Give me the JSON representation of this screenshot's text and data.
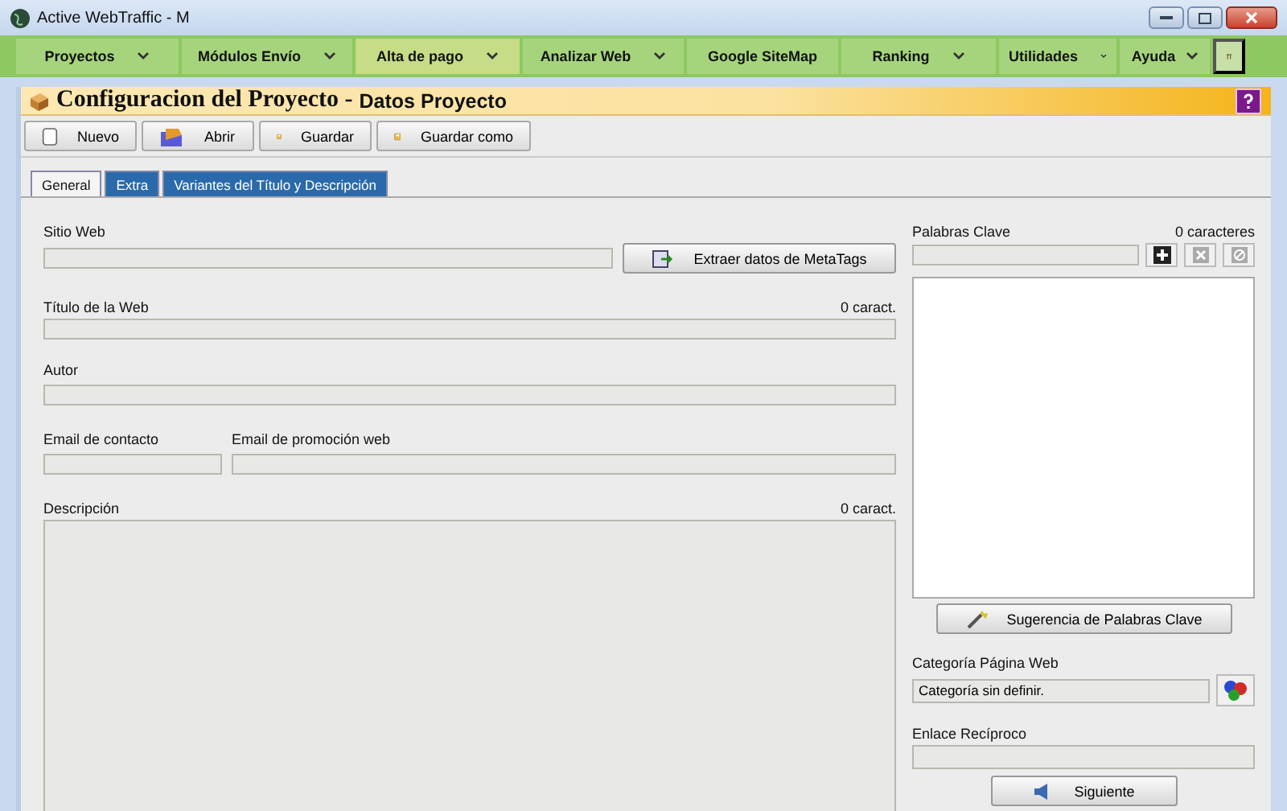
{
  "window": {
    "title": "Active WebTraffic - M"
  },
  "menu": [
    {
      "label": "Proyectos",
      "selected": false,
      "dropdown": true
    },
    {
      "label": "Módulos Envío",
      "selected": false,
      "dropdown": true
    },
    {
      "label": "Alta de pago",
      "selected": true,
      "dropdown": true
    },
    {
      "label": "Analizar Web",
      "selected": false,
      "dropdown": true
    },
    {
      "label": "Google SiteMap",
      "selected": false,
      "dropdown": false
    },
    {
      "label": "Ranking",
      "selected": false,
      "dropdown": true
    },
    {
      "label": "Utilidades",
      "selected": false,
      "dropdown": true
    },
    {
      "label": "Ayuda",
      "selected": false,
      "dropdown": true
    }
  ],
  "header": {
    "title": "Configuracion del Proyecto -",
    "subtitle": "Datos Proyecto"
  },
  "toolbar": [
    {
      "label": "Nuevo",
      "kind": "new"
    },
    {
      "label": "Abrir",
      "kind": "open"
    },
    {
      "label": "Guardar",
      "kind": "save"
    },
    {
      "label": "Guardar como",
      "kind": "save"
    }
  ],
  "tabs": [
    {
      "label": "General",
      "selected": true
    },
    {
      "label": "Extra",
      "selected": false
    },
    {
      "label": "Variantes del Título y Descripción",
      "selected": false
    }
  ],
  "form": {
    "site": {
      "label": "Sitio Web",
      "button": "Extraer datos de MetaTags"
    },
    "title": {
      "label": "Título de la Web",
      "counter": "0 caract."
    },
    "author": {
      "label": "Autor"
    },
    "email_contact": {
      "label": "Email de contacto"
    },
    "email_promo": {
      "label": "Email de promoción web"
    },
    "description": {
      "label": "Descripción",
      "counter": "0 caract."
    }
  },
  "keywords": {
    "label": "Palabras Clave",
    "counter": "0 caracteres",
    "suggest_button": "Sugerencia de Palabras Clave"
  },
  "category": {
    "label": "Categoría Página Web",
    "value": "Categoría sin definir."
  },
  "reciprocal": {
    "label": "Enlace Recíproco"
  },
  "next_button": "Siguiente"
}
